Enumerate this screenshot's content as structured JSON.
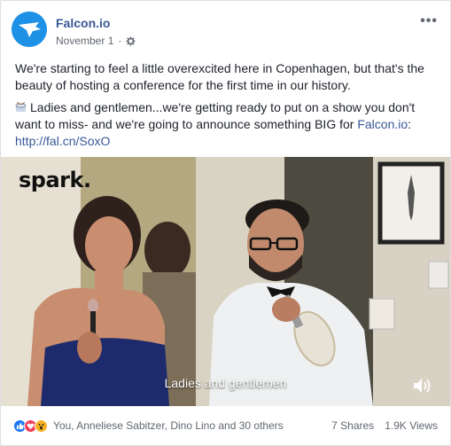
{
  "post": {
    "page_name": "Falcon.io",
    "date": "November 1",
    "more_label": "•••",
    "text_line1": "We're starting to feel a little overexcited here in Copenhagen, but that's the beauty of hosting a conference for the first time in our history.",
    "text_line2": "Ladies and gentlemen...we're getting ready to put on a show you don't want to miss- and we're going to announce something BIG for ",
    "mention": "Falcon.io",
    "text_line2_end": ":",
    "url": "http://fal.cn/SoxO"
  },
  "video": {
    "brand_logo": "spark.",
    "caption": "Ladies and gentlemen"
  },
  "footer": {
    "reactions": [
      "like-icon",
      "love-icon",
      "wow-icon"
    ],
    "reaction_names": "You, Anneliese Sabitzer, Dino Lino and 30 others",
    "shares": "7 Shares",
    "views": "1.9K Views"
  },
  "colors": {
    "link": "#385898",
    "avatar": "#1e90e6",
    "like": "#1877f2",
    "love": "#f33e58",
    "wow": "#f7b125"
  }
}
